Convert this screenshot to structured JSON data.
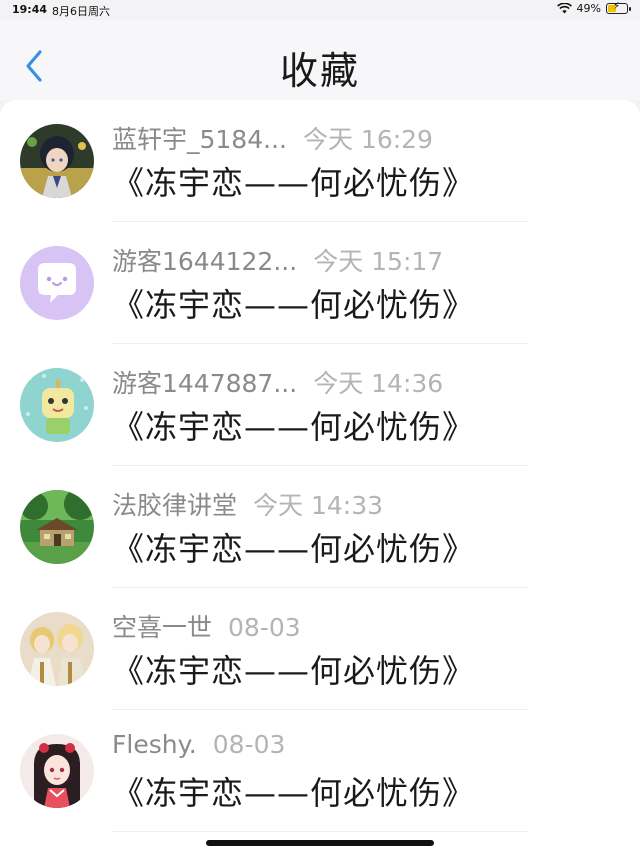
{
  "status_bar": {
    "time": "19:44",
    "date": "8月6日周六",
    "battery_percent_text": "49%",
    "battery_level": 0.49,
    "icons": [
      "wifi-icon",
      "battery-charging-icon"
    ]
  },
  "nav": {
    "title": "收藏",
    "back_icon": "chevron-left-icon",
    "accent_color": "#3a8ee6"
  },
  "items": [
    {
      "user": "蓝轩宇_5184...",
      "time": "今天 16:29",
      "title": "《冻宇恋——何必忧伤》",
      "avatar": "anime-boy-avatar"
    },
    {
      "user": "游客1644122...",
      "time": "今天 15:17",
      "title": "《冻宇恋——何必忧伤》",
      "avatar": "chat-bubble-avatar"
    },
    {
      "user": "游客1447887...",
      "time": "今天 14:36",
      "title": "《冻宇恋——何必忧伤》",
      "avatar": "cartoon-character-avatar"
    },
    {
      "user": "法胶律讲堂",
      "time": "今天 14:33",
      "title": "《冻宇恋——何必忧伤》",
      "avatar": "forest-house-avatar"
    },
    {
      "user": "空喜一世",
      "time": "08-03",
      "title": "《冻宇恋——何必忧伤》",
      "avatar": "anime-group-avatar"
    },
    {
      "user": "Fleshy.",
      "time": "08-03",
      "title": "《冻宇恋——何必忧伤》",
      "avatar": "anime-girl-avatar"
    }
  ]
}
